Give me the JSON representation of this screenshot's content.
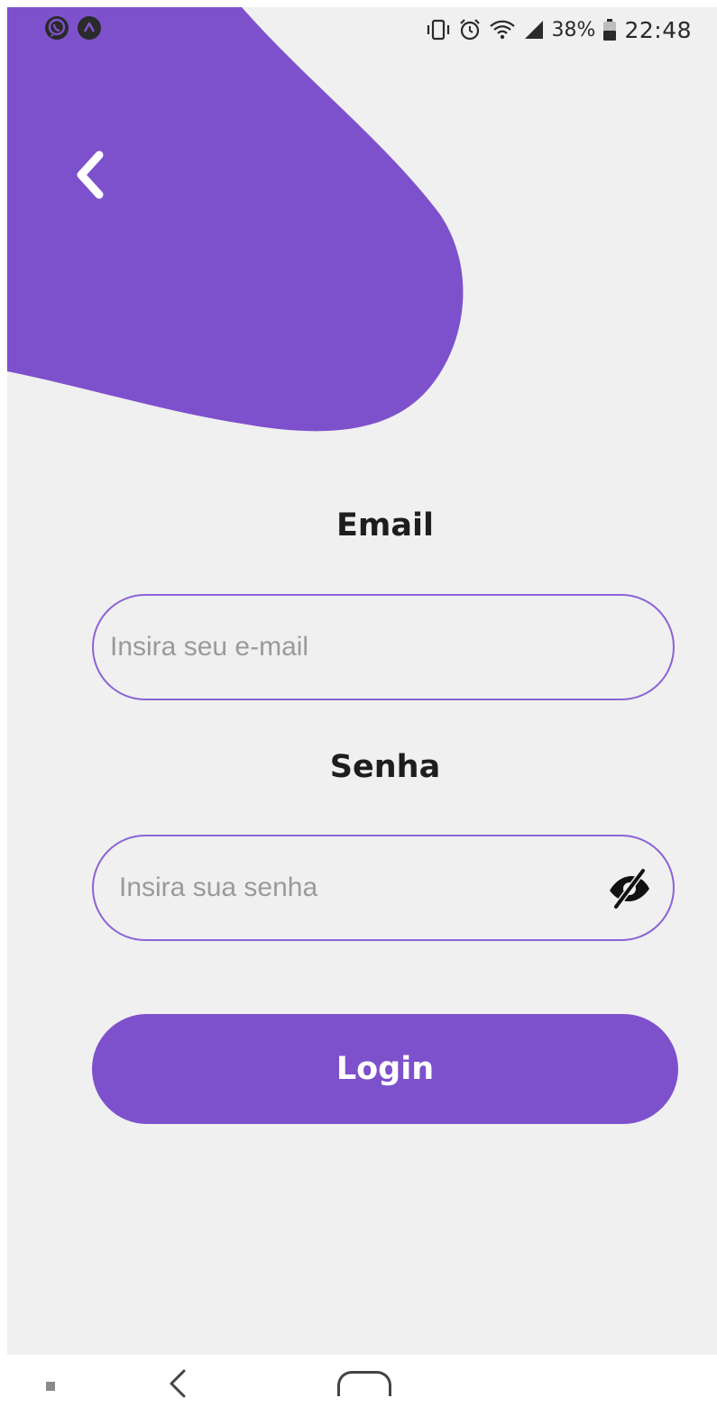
{
  "status_bar": {
    "left_icons": [
      "whatsapp-icon",
      "app-notification-icon"
    ],
    "right_icons": [
      "vibrate-icon",
      "alarm-icon",
      "wifi-icon",
      "signal-icon",
      "battery-icon"
    ],
    "battery_percent": "38%",
    "time": "22:48"
  },
  "header": {
    "back_icon": "chevron-left-icon"
  },
  "form": {
    "email_label": "Email",
    "email_placeholder": "Insira seu e-mail",
    "email_value": "",
    "password_label": "Senha",
    "password_placeholder": "Insira sua senha",
    "password_value": "",
    "password_toggle_icon": "eye-off-icon",
    "login_label": "Login"
  },
  "navigation_bar": {
    "buttons": [
      "recents-button",
      "back-button",
      "home-button"
    ]
  },
  "colors": {
    "accent": "#7e51cc",
    "field_border": "#8b63d6",
    "background": "#f0f0f0",
    "text": "#1e1e1e",
    "placeholder": "#9a9a9a"
  }
}
